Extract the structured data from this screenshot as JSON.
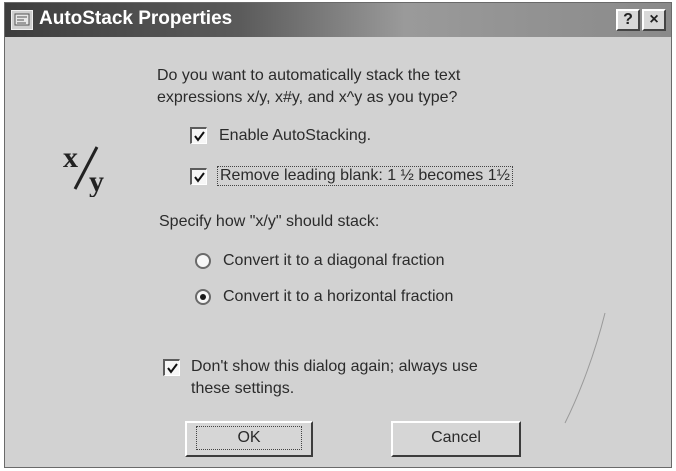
{
  "window": {
    "title": "AutoStack Properties",
    "help_label": "?",
    "close_label": "×"
  },
  "question": {
    "line1": "Do you want to automatically stack the text",
    "line2": "expressions x/y, x#y, and x^y as you type?"
  },
  "options": {
    "enable_autostacking": {
      "label": "Enable AutoStacking.",
      "checked": true
    },
    "remove_leading_blank": {
      "label": "Remove leading blank:  1 ½  becomes 1½",
      "checked": true
    }
  },
  "stack_prompt": "Specify how \"x/y\" should stack:",
  "stack_options": [
    {
      "label": "Convert it to a diagonal fraction",
      "selected": false
    },
    {
      "label": "Convert it to a horizontal fraction",
      "selected": true
    }
  ],
  "dont_show": {
    "line1": "Don't show this dialog again; always use",
    "line2": "these settings.",
    "checked": true
  },
  "buttons": {
    "ok_label": "OK",
    "cancel_label": "Cancel"
  },
  "icons": {
    "window_icon": "autostack-window-icon",
    "fraction_graphic": "x-over-y-fraction-icon"
  }
}
